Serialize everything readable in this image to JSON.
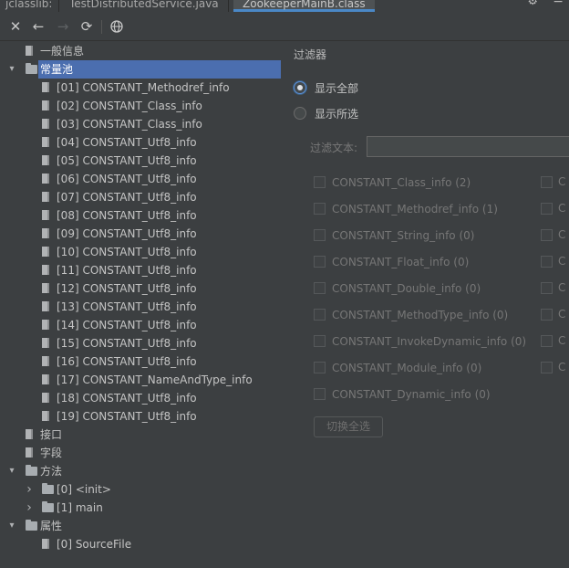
{
  "tabs": [
    {
      "label": "jclasslib:"
    },
    {
      "label": "TestDistributedService.java"
    },
    {
      "label": "ZookeeperMainB.class"
    }
  ],
  "toolbar": {
    "close_icon": "close-icon",
    "back_icon": "arrow-left-icon",
    "forward_icon": "arrow-right-icon",
    "refresh_icon": "refresh-icon",
    "web_icon": "globe-icon"
  },
  "tree": {
    "general_info": "一般信息",
    "constant_pool": "常量池",
    "constants": [
      "[01] CONSTANT_Methodref_info",
      "[02] CONSTANT_Class_info",
      "[03] CONSTANT_Class_info",
      "[04] CONSTANT_Utf8_info",
      "[05] CONSTANT_Utf8_info",
      "[06] CONSTANT_Utf8_info",
      "[07] CONSTANT_Utf8_info",
      "[08] CONSTANT_Utf8_info",
      "[09] CONSTANT_Utf8_info",
      "[10] CONSTANT_Utf8_info",
      "[11] CONSTANT_Utf8_info",
      "[12] CONSTANT_Utf8_info",
      "[13] CONSTANT_Utf8_info",
      "[14] CONSTANT_Utf8_info",
      "[15] CONSTANT_Utf8_info",
      "[16] CONSTANT_Utf8_info",
      "[17] CONSTANT_NameAndType_info",
      "[18] CONSTANT_Utf8_info",
      "[19] CONSTANT_Utf8_info"
    ],
    "interfaces": "接口",
    "fields": "字段",
    "methods": "方法",
    "method_items": [
      "[0] <init>",
      "[1] main"
    ],
    "attributes": "属性",
    "attribute_items": [
      "[0] SourceFile"
    ]
  },
  "filter": {
    "title": "过滤器",
    "show_all": "显示全部",
    "show_selected": "显示所选",
    "text_label": "过滤文本:",
    "text_value": "",
    "checkboxes": [
      "CONSTANT_Class_info (2)",
      "CONSTANT_Methodref_info (1)",
      "CONSTANT_String_info (0)",
      "CONSTANT_Float_info (0)",
      "CONSTANT_Double_info (0)",
      "CONSTANT_MethodType_info (0)",
      "CONSTANT_InvokeDynamic_info (0)",
      "CONSTANT_Module_info (0)",
      "CONSTANT_Dynamic_info (0)"
    ],
    "second_column_labels": [
      "C",
      "C",
      "C",
      "C",
      "C",
      "C",
      "C",
      "C"
    ],
    "toggle_all": "切换全选"
  },
  "colors": {
    "background": "#3c3f41",
    "selection": "#4b6eaf",
    "active_tab_underline": "#4a88c7"
  }
}
